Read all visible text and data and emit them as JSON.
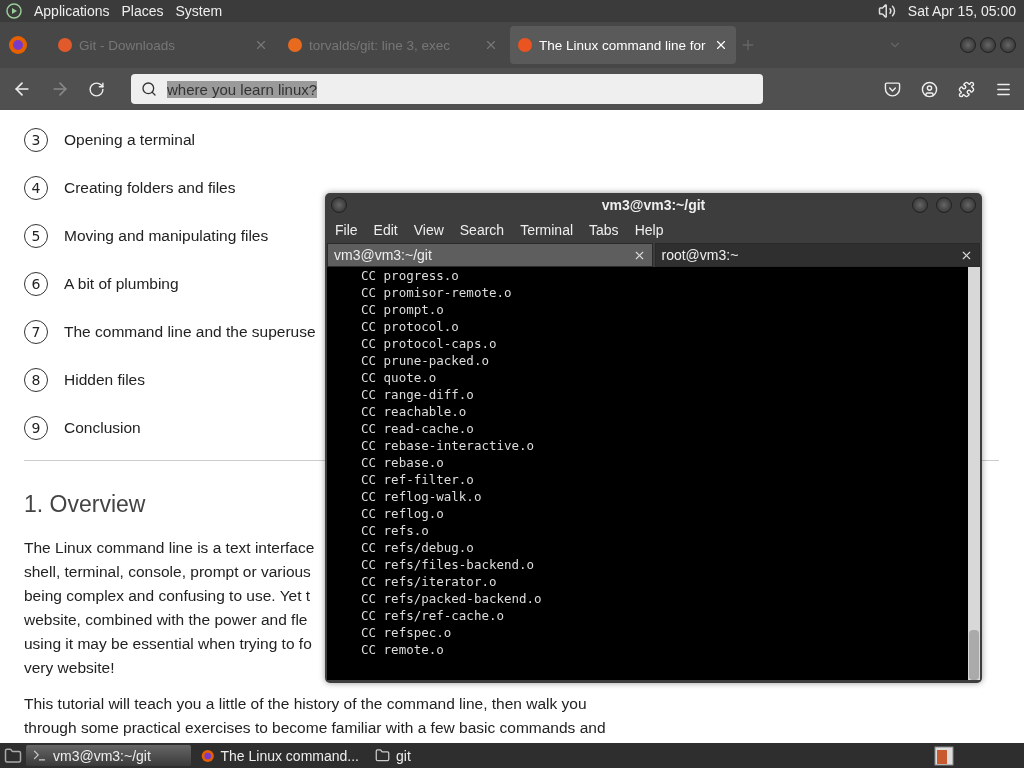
{
  "top_panel": {
    "menus": [
      "Applications",
      "Places",
      "System"
    ],
    "clock": "Sat Apr 15, 05:00"
  },
  "browser": {
    "tabs": [
      {
        "title": "Git - Downloads",
        "selected": false
      },
      {
        "title": "torvalds/git: line 3, exec",
        "selected": false
      },
      {
        "title": "The Linux command line for",
        "selected": true
      }
    ],
    "address": "where you learn linux?"
  },
  "page": {
    "steps": [
      {
        "number": "3",
        "title": "Opening a terminal"
      },
      {
        "number": "4",
        "title": "Creating folders and files"
      },
      {
        "number": "5",
        "title": "Moving and manipulating files"
      },
      {
        "number": "6",
        "title": "A bit of plumbing"
      },
      {
        "number": "7",
        "title": "The command line and the superuse"
      },
      {
        "number": "8",
        "title": "Hidden files"
      },
      {
        "number": "9",
        "title": "Conclusion"
      }
    ],
    "heading": "1. Overview",
    "paragraph_1": [
      "The Linux command line is a text interface",
      "shell, terminal, console, prompt or various",
      "being complex and confusing to use. Yet t",
      "website, combined with the power and fle",
      "using it may be essential when trying to fo",
      "very website!"
    ],
    "paragraph_2": [
      "This tutorial will teach you a little of the history of the command line, then walk you",
      "through some practical exercises to become familiar with a few basic commands and"
    ]
  },
  "terminal": {
    "title": "vm3@vm3:~/git",
    "menus": [
      "File",
      "Edit",
      "View",
      "Search",
      "Terminal",
      "Tabs",
      "Help"
    ],
    "tabs": [
      {
        "title": "vm3@vm3:~/git",
        "selected": true
      },
      {
        "title": "root@vm3:~",
        "selected": false
      }
    ],
    "lines": [
      "CC progress.o",
      "CC promisor-remote.o",
      "CC prompt.o",
      "CC protocol.o",
      "CC protocol-caps.o",
      "CC prune-packed.o",
      "CC quote.o",
      "CC range-diff.o",
      "CC reachable.o",
      "CC read-cache.o",
      "CC rebase-interactive.o",
      "CC rebase.o",
      "CC ref-filter.o",
      "CC reflog-walk.o",
      "CC reflog.o",
      "CC refs.o",
      "CC refs/debug.o",
      "CC refs/files-backend.o",
      "CC refs/iterator.o",
      "CC refs/packed-backend.o",
      "CC refs/ref-cache.o",
      "CC refspec.o",
      "CC remote.o"
    ]
  },
  "taskbar": {
    "items": [
      {
        "title": "vm3@vm3:~/git",
        "kind": "terminal",
        "selected": true
      },
      {
        "title": "The Linux command...",
        "kind": "browser",
        "selected": false
      },
      {
        "title": "git",
        "kind": "folder",
        "selected": false
      }
    ]
  }
}
